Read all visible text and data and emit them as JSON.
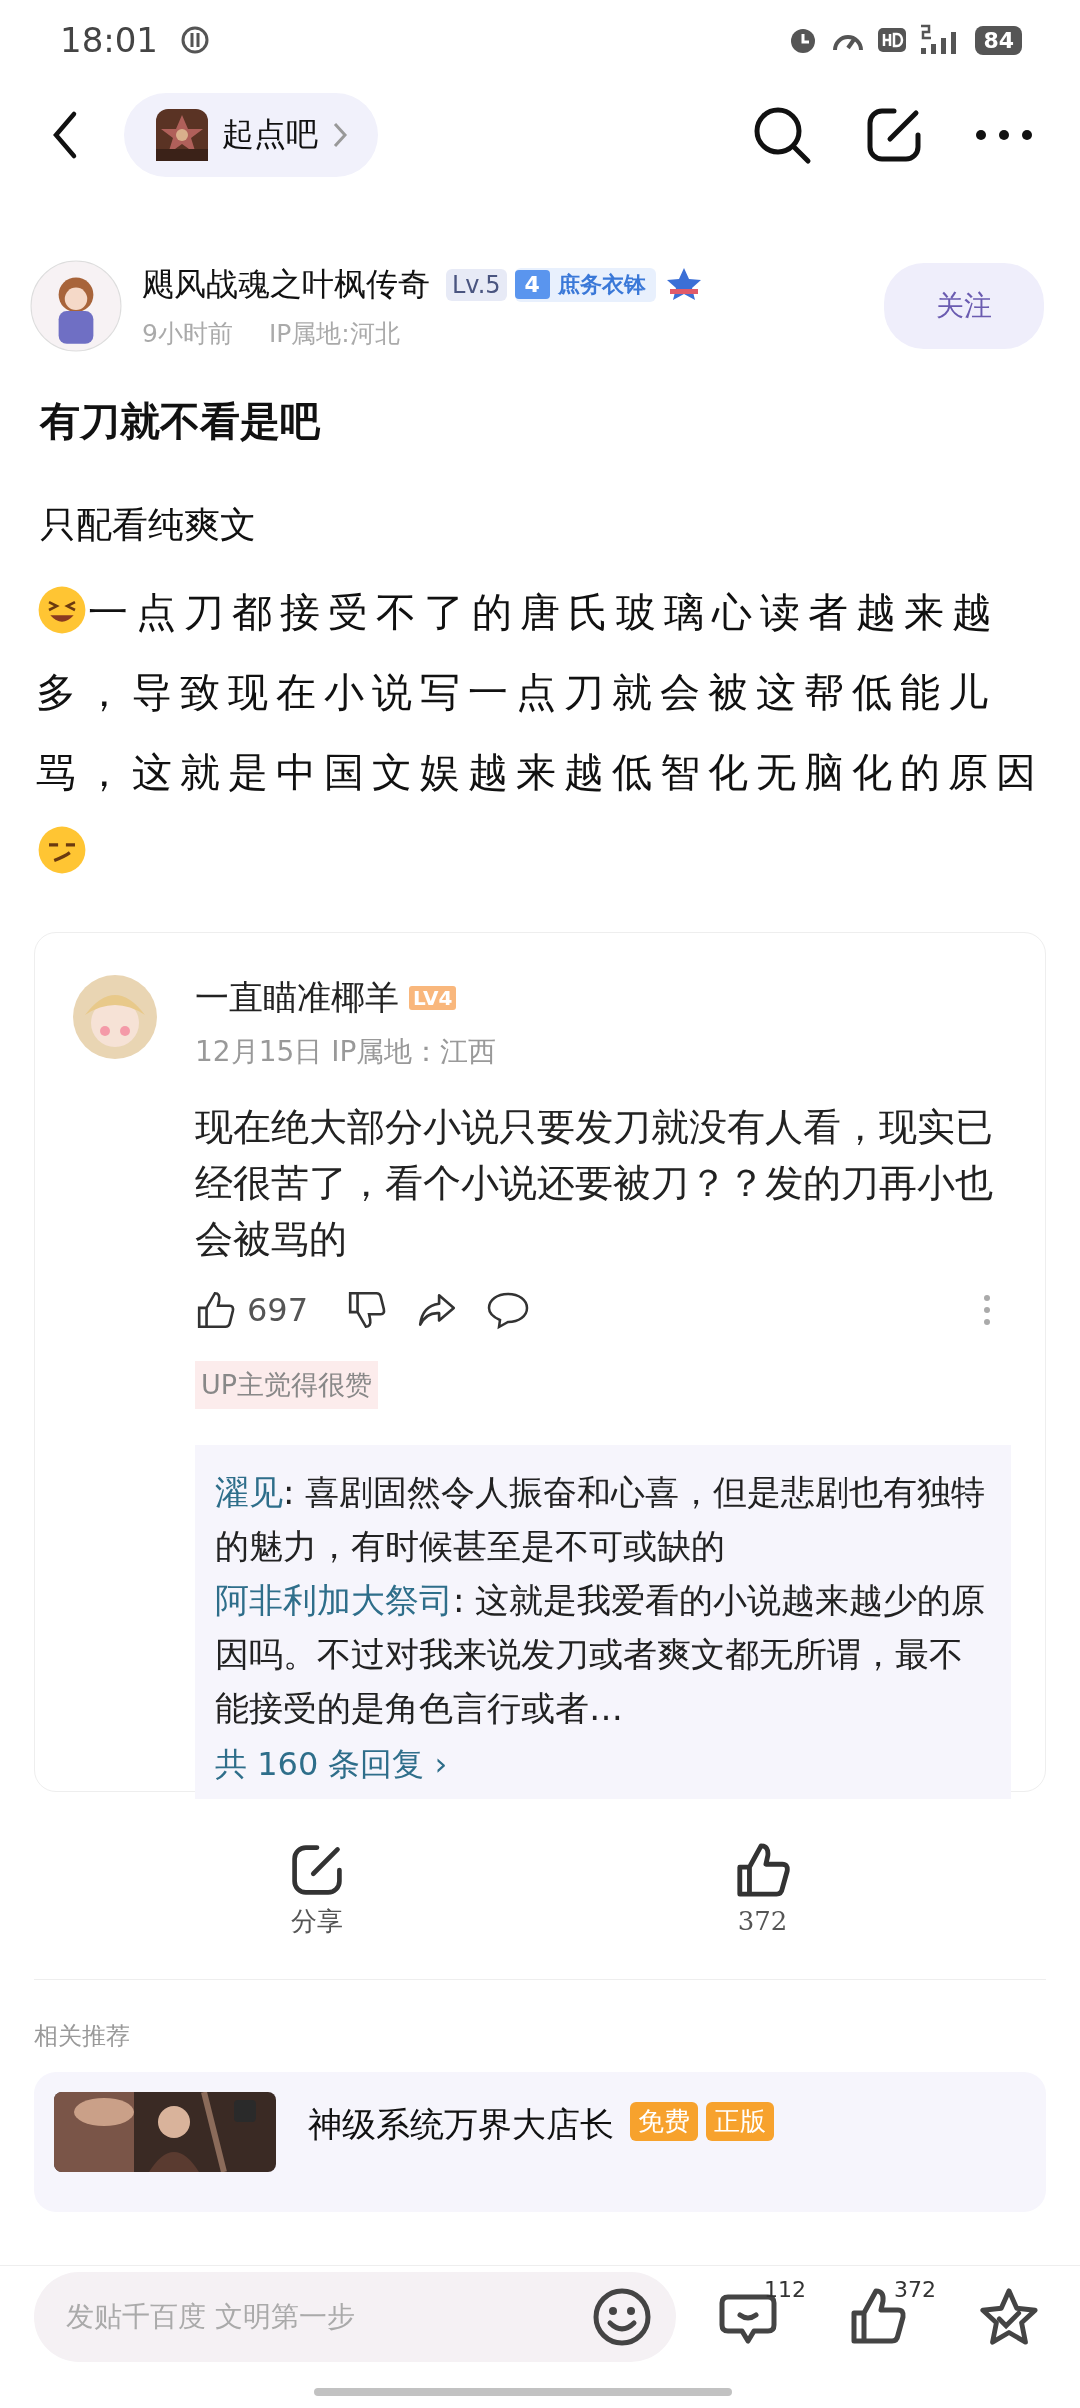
{
  "status_bar": {
    "time": "18:01",
    "battery": "84"
  },
  "nav": {
    "forum": "起点吧"
  },
  "author": {
    "name": "飓风战魂之叶枫传奇",
    "level": "Lv.5",
    "rank_number": "4",
    "rank_title": "庶务衣钵",
    "time": "9小时前",
    "ip": "IP属地:河北",
    "follow": "关注"
  },
  "post": {
    "title": "有刀就不看是吧",
    "subtitle": "只配看纯爽文",
    "body": "一点刀都接受不了的唐氏玻璃心读者越来越多，导致现在小说写一点刀就会被这帮低能儿骂，这就是中国文娱越来越低智化无脑化的原因"
  },
  "quoted_comment": {
    "name": "一直瞄准椰羊",
    "level": "LV4",
    "date": "12月15日 IP属地：江西",
    "text": "现在绝大部分小说只要发刀就没有人看，现实已经很苦了，看个小说还要被刀？？发的刀再小也会被骂的",
    "likes": "697",
    "tag": "UP主觉得很赞",
    "replies": [
      {
        "name": "濯见",
        "text": ": 喜剧固然令人振奋和心喜，但是悲剧也有独特的魅力，有时候甚至是不可或缺的"
      },
      {
        "name": "阿非利加大祭司",
        "text": ": 这就是我爱看的小说越来越少的原因吗。不过对我来说发刀或者爽文都无所谓，最不能接受的是角色言行或者…"
      }
    ],
    "more_replies": "共 160 条回复 ›"
  },
  "actions": [
    {
      "kind": "share",
      "label": "分享"
    },
    {
      "kind": "like",
      "label": "372"
    }
  ],
  "related": {
    "heading": "相关推荐",
    "items": [
      {
        "title": "神级系统万界大店长",
        "badges": [
          "免费",
          "正版"
        ]
      }
    ]
  },
  "bottom_bar": {
    "placeholder": "发贴千百度 文明第一步",
    "comments": "112",
    "likes": "372"
  }
}
